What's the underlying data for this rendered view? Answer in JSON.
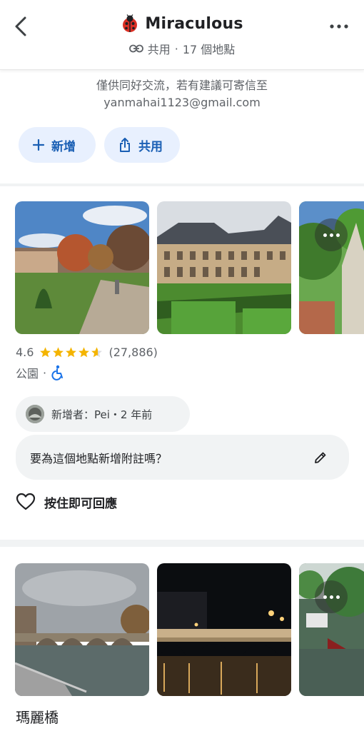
{
  "header": {
    "back_icon": "chevron-left-icon",
    "list_emoji_icon": "ladybug-icon",
    "title": "Miraculous",
    "share_status": "共用",
    "separator": "·",
    "place_count": "17 個地點",
    "more_icon": "more-horizontal-icon"
  },
  "description": {
    "line1": "僅供同好交流，若有建議可寄信至",
    "line2": "yanmahai1123@gmail.com"
  },
  "actions": {
    "add_label": "新增",
    "share_label": "共用"
  },
  "place1": {
    "rating": "4.6",
    "stars_value": 4.6,
    "review_count": "(27,886)",
    "category": "公園",
    "separator": "·",
    "accessibility_icon": "wheelchair-icon",
    "added_by": "新增者：Pei・2 年前",
    "note_prompt": "要為這個地點新增附註嗎？",
    "react_label": "按住即可回應"
  },
  "place2": {
    "name": "瑪麗橋"
  },
  "colors": {
    "accent": "#1a5fb4",
    "pill_bg": "#e8f0fe",
    "star": "#f4b400",
    "muted_text": "#5f6368"
  }
}
